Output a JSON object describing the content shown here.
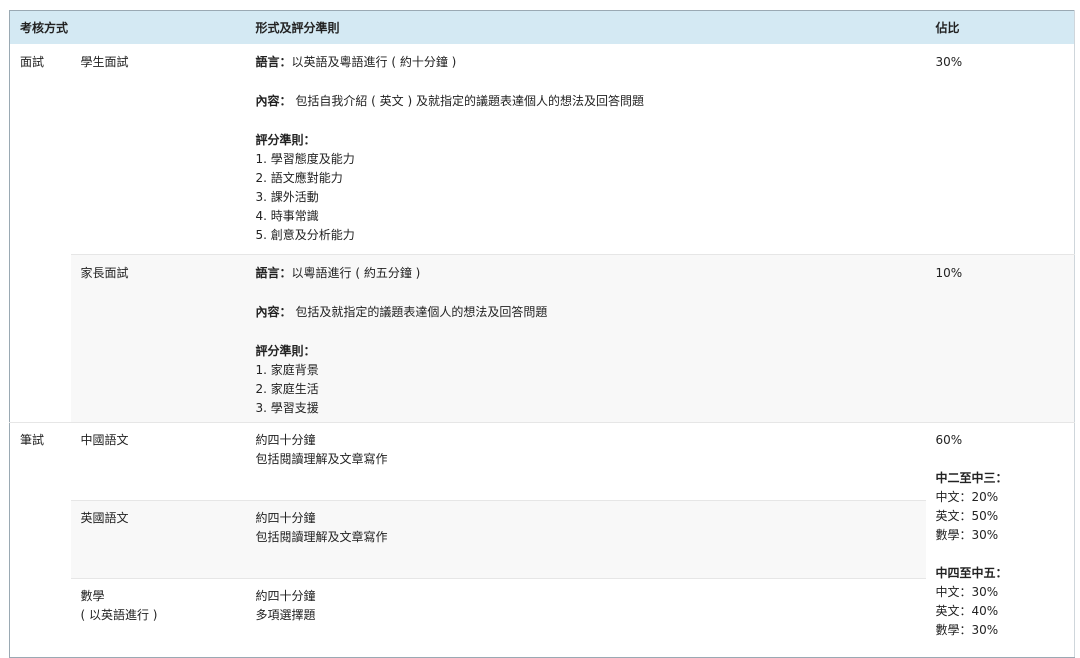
{
  "header": {
    "col_method": "考核方式",
    "col_criteria": "形式及評分準則",
    "col_weight": "佔比"
  },
  "interview": {
    "category": "面試",
    "student": {
      "name": "學生面試",
      "language_label": "語言：",
      "language_text": "以英語及粵語進行 ( 約十分鐘 )",
      "content_label": "內容：",
      "content_text": " 包括自我介紹 ( 英文 ) 及就指定的議題表達個人的想法及回答問題",
      "criteria_label": "評分準則：",
      "criteria": [
        "1. 學習態度及能力",
        "2. 語文應對能力",
        "3. 課外活動",
        "4. 時事常識",
        "5. 創意及分析能力"
      ],
      "weight": "30%"
    },
    "parent": {
      "name": "家長面試",
      "language_label": "語言：",
      "language_text": "以粵語進行 ( 約五分鐘 )",
      "content_label": "內容：",
      "content_text": " 包括及就指定的議題表達個人的想法及回答問題",
      "criteria_label": "評分準則：",
      "criteria": [
        "1. 家庭背景",
        "2. 家庭生活",
        "3. 學習支援"
      ],
      "weight": "10%"
    }
  },
  "written": {
    "category": "筆試",
    "subjects": [
      {
        "name": "中國語文",
        "name_line2": "",
        "lines": [
          "約四十分鐘",
          "包括閱讀理解及文章寫作"
        ]
      },
      {
        "name": "英國語文",
        "name_line2": "",
        "lines": [
          "約四十分鐘",
          "包括閱讀理解及文章寫作"
        ]
      },
      {
        "name": "數學",
        "name_line2": "( 以英語進行 )",
        "lines": [
          "約四十分鐘",
          "多項選擇題"
        ]
      }
    ],
    "weight": "60%",
    "breakdown": [
      {
        "title": "中二至中三：",
        "items": [
          "中文：20%",
          "英文：50%",
          "數學：30%"
        ]
      },
      {
        "title": "中四至中五：",
        "items": [
          "中文：30%",
          "英文：40%",
          "數學：30%"
        ]
      }
    ]
  }
}
